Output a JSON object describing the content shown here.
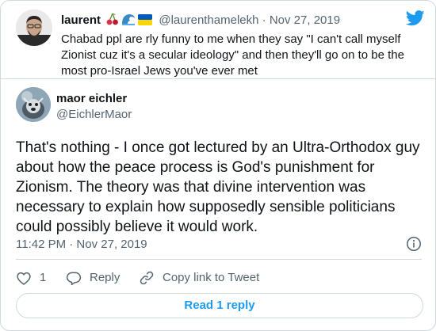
{
  "quoted_tweet": {
    "name": "laurent",
    "name_emojis": [
      "cherries-emoji",
      "wave-emoji",
      "ukraine-flag-emoji"
    ],
    "handle": "@laurenthamelekh",
    "separator": "·",
    "date": "Nov 27, 2019",
    "text": "Chabad ppl are rly funny to me when they say \"I can't call myself Zionist cuz it's a secular ideology\" and then they'll go on to be the most pro-Israel Jews you've ever met"
  },
  "tweet": {
    "name": "maor eichler",
    "handle": "@EichlerMaor",
    "text": "That's nothing - I once got lectured by an Ultra-Orthodox guy about how the peace process is God's punishment for Zionism. The theory was that divine intervention was necessary to explain how supposedly sensible politicians could possibly believe it would work.",
    "timestamp": "11:42 PM · Nov 27, 2019"
  },
  "actions": {
    "like_count": "1",
    "reply_label": "Reply",
    "copy_link_label": "Copy link to Tweet"
  },
  "read_replies_label": "Read 1 reply",
  "colors": {
    "brand_blue": "#1d9bf0",
    "secondary_text": "#536471",
    "border": "#cfd9de"
  }
}
